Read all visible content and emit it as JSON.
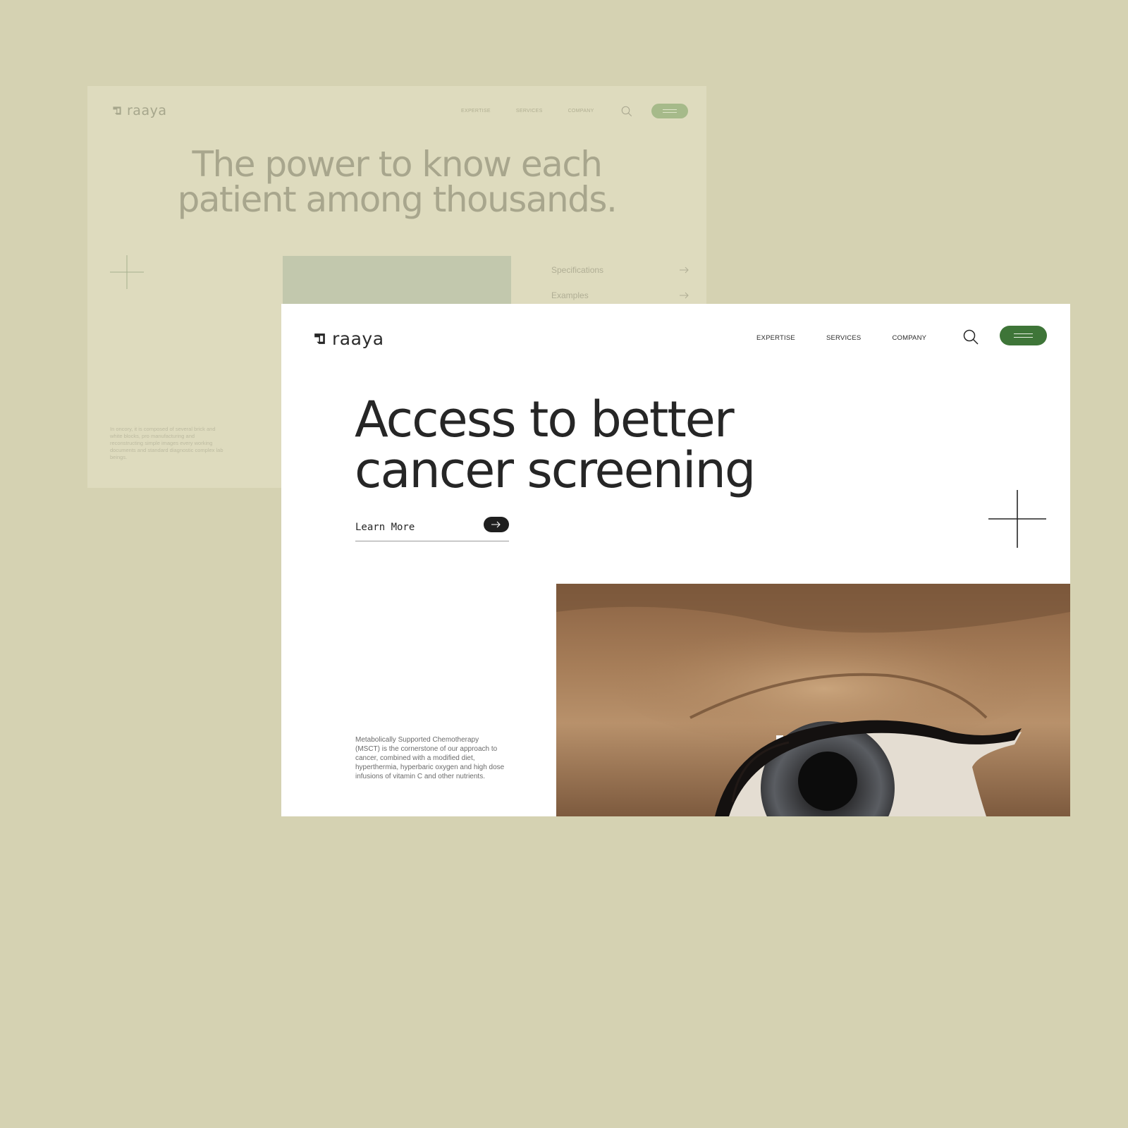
{
  "back_page": {
    "logo_text": "raaya",
    "nav": [
      "EXPERTISE",
      "SERVICES",
      "COMPANY"
    ],
    "headline_line1": "The power to know each",
    "headline_line2": "patient among thousands.",
    "list": [
      {
        "label": "Specifications"
      },
      {
        "label": "Examples"
      }
    ],
    "paragraph": "In oncory, it is composed of several brick and white blocks, pro manufacturing and reconstructing simple images every working documents and standard diagnostic complex lab beings."
  },
  "front_page": {
    "logo_text": "raaya",
    "nav": [
      "EXPERTISE",
      "SERVICES",
      "COMPANY"
    ],
    "headline_line1": "Access to better",
    "headline_line2": "cancer screening",
    "cta_label": "Learn More",
    "paragraph": "Metabolically Supported Chemotherapy (MSCT) is the cornerstone of our approach to cancer, combined with a modified diet, hyperthermia, hyperbaric oxygen and high dose infusions of vitamin C and other nutrients."
  },
  "icons": {
    "logo": "raaya-logo-icon",
    "search": "search-icon",
    "menu": "hamburger-menu-icon",
    "arrow": "arrow-right-icon",
    "crosshair": "crosshair-plus-icon"
  },
  "colors": {
    "canvas": "#d5d2b2",
    "back_page": "#dedbbe",
    "front_page": "#ffffff",
    "accent_green": "#3e7538",
    "text_dark": "#262626"
  }
}
